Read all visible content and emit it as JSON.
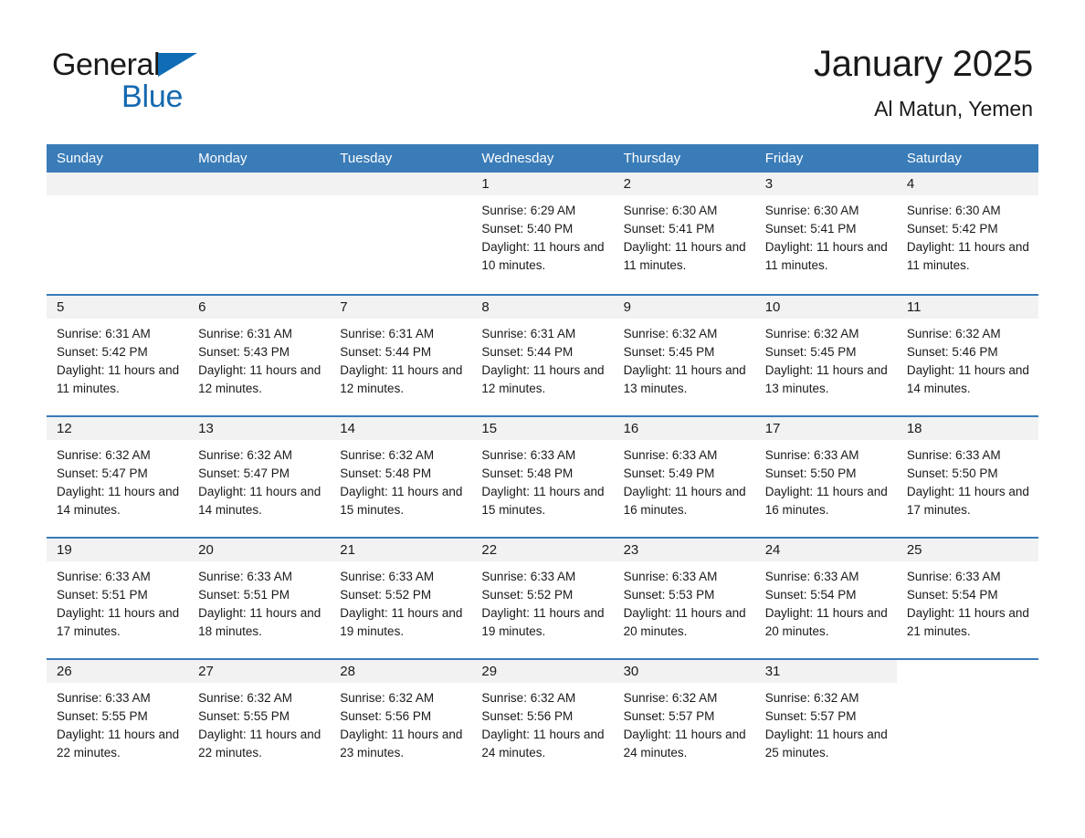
{
  "brand": {
    "name_part1": "General",
    "name_part2": "Blue",
    "triangle_icon": "triangle-icon",
    "accent_color": "#1569b0"
  },
  "header": {
    "month_title": "January 2025",
    "location": "Al Matun, Yemen"
  },
  "colors": {
    "header_blue": "#3a7cb8",
    "row_divider_blue": "#3a7cb8",
    "day_band_gray": "#f2f2f2",
    "text": "#1a1a1a"
  },
  "calendar": {
    "weekdays": [
      "Sunday",
      "Monday",
      "Tuesday",
      "Wednesday",
      "Thursday",
      "Friday",
      "Saturday"
    ],
    "weeks": [
      [
        {
          "day": "",
          "empty": true
        },
        {
          "day": "",
          "empty": true
        },
        {
          "day": "",
          "empty": true
        },
        {
          "day": "1",
          "sunrise": "Sunrise: 6:29 AM",
          "sunset": "Sunset: 5:40 PM",
          "daylight": "Daylight: 11 hours and 10 minutes."
        },
        {
          "day": "2",
          "sunrise": "Sunrise: 6:30 AM",
          "sunset": "Sunset: 5:41 PM",
          "daylight": "Daylight: 11 hours and 11 minutes."
        },
        {
          "day": "3",
          "sunrise": "Sunrise: 6:30 AM",
          "sunset": "Sunset: 5:41 PM",
          "daylight": "Daylight: 11 hours and 11 minutes."
        },
        {
          "day": "4",
          "sunrise": "Sunrise: 6:30 AM",
          "sunset": "Sunset: 5:42 PM",
          "daylight": "Daylight: 11 hours and 11 minutes."
        }
      ],
      [
        {
          "day": "5",
          "sunrise": "Sunrise: 6:31 AM",
          "sunset": "Sunset: 5:42 PM",
          "daylight": "Daylight: 11 hours and 11 minutes."
        },
        {
          "day": "6",
          "sunrise": "Sunrise: 6:31 AM",
          "sunset": "Sunset: 5:43 PM",
          "daylight": "Daylight: 11 hours and 12 minutes."
        },
        {
          "day": "7",
          "sunrise": "Sunrise: 6:31 AM",
          "sunset": "Sunset: 5:44 PM",
          "daylight": "Daylight: 11 hours and 12 minutes."
        },
        {
          "day": "8",
          "sunrise": "Sunrise: 6:31 AM",
          "sunset": "Sunset: 5:44 PM",
          "daylight": "Daylight: 11 hours and 12 minutes."
        },
        {
          "day": "9",
          "sunrise": "Sunrise: 6:32 AM",
          "sunset": "Sunset: 5:45 PM",
          "daylight": "Daylight: 11 hours and 13 minutes."
        },
        {
          "day": "10",
          "sunrise": "Sunrise: 6:32 AM",
          "sunset": "Sunset: 5:45 PM",
          "daylight": "Daylight: 11 hours and 13 minutes."
        },
        {
          "day": "11",
          "sunrise": "Sunrise: 6:32 AM",
          "sunset": "Sunset: 5:46 PM",
          "daylight": "Daylight: 11 hours and 14 minutes."
        }
      ],
      [
        {
          "day": "12",
          "sunrise": "Sunrise: 6:32 AM",
          "sunset": "Sunset: 5:47 PM",
          "daylight": "Daylight: 11 hours and 14 minutes."
        },
        {
          "day": "13",
          "sunrise": "Sunrise: 6:32 AM",
          "sunset": "Sunset: 5:47 PM",
          "daylight": "Daylight: 11 hours and 14 minutes."
        },
        {
          "day": "14",
          "sunrise": "Sunrise: 6:32 AM",
          "sunset": "Sunset: 5:48 PM",
          "daylight": "Daylight: 11 hours and 15 minutes."
        },
        {
          "day": "15",
          "sunrise": "Sunrise: 6:33 AM",
          "sunset": "Sunset: 5:48 PM",
          "daylight": "Daylight: 11 hours and 15 minutes."
        },
        {
          "day": "16",
          "sunrise": "Sunrise: 6:33 AM",
          "sunset": "Sunset: 5:49 PM",
          "daylight": "Daylight: 11 hours and 16 minutes."
        },
        {
          "day": "17",
          "sunrise": "Sunrise: 6:33 AM",
          "sunset": "Sunset: 5:50 PM",
          "daylight": "Daylight: 11 hours and 16 minutes."
        },
        {
          "day": "18",
          "sunrise": "Sunrise: 6:33 AM",
          "sunset": "Sunset: 5:50 PM",
          "daylight": "Daylight: 11 hours and 17 minutes."
        }
      ],
      [
        {
          "day": "19",
          "sunrise": "Sunrise: 6:33 AM",
          "sunset": "Sunset: 5:51 PM",
          "daylight": "Daylight: 11 hours and 17 minutes."
        },
        {
          "day": "20",
          "sunrise": "Sunrise: 6:33 AM",
          "sunset": "Sunset: 5:51 PM",
          "daylight": "Daylight: 11 hours and 18 minutes."
        },
        {
          "day": "21",
          "sunrise": "Sunrise: 6:33 AM",
          "sunset": "Sunset: 5:52 PM",
          "daylight": "Daylight: 11 hours and 19 minutes."
        },
        {
          "day": "22",
          "sunrise": "Sunrise: 6:33 AM",
          "sunset": "Sunset: 5:52 PM",
          "daylight": "Daylight: 11 hours and 19 minutes."
        },
        {
          "day": "23",
          "sunrise": "Sunrise: 6:33 AM",
          "sunset": "Sunset: 5:53 PM",
          "daylight": "Daylight: 11 hours and 20 minutes."
        },
        {
          "day": "24",
          "sunrise": "Sunrise: 6:33 AM",
          "sunset": "Sunset: 5:54 PM",
          "daylight": "Daylight: 11 hours and 20 minutes."
        },
        {
          "day": "25",
          "sunrise": "Sunrise: 6:33 AM",
          "sunset": "Sunset: 5:54 PM",
          "daylight": "Daylight: 11 hours and 21 minutes."
        }
      ],
      [
        {
          "day": "26",
          "sunrise": "Sunrise: 6:33 AM",
          "sunset": "Sunset: 5:55 PM",
          "daylight": "Daylight: 11 hours and 22 minutes."
        },
        {
          "day": "27",
          "sunrise": "Sunrise: 6:32 AM",
          "sunset": "Sunset: 5:55 PM",
          "daylight": "Daylight: 11 hours and 22 minutes."
        },
        {
          "day": "28",
          "sunrise": "Sunrise: 6:32 AM",
          "sunset": "Sunset: 5:56 PM",
          "daylight": "Daylight: 11 hours and 23 minutes."
        },
        {
          "day": "29",
          "sunrise": "Sunrise: 6:32 AM",
          "sunset": "Sunset: 5:56 PM",
          "daylight": "Daylight: 11 hours and 24 minutes."
        },
        {
          "day": "30",
          "sunrise": "Sunrise: 6:32 AM",
          "sunset": "Sunset: 5:57 PM",
          "daylight": "Daylight: 11 hours and 24 minutes."
        },
        {
          "day": "31",
          "sunrise": "Sunrise: 6:32 AM",
          "sunset": "Sunset: 5:57 PM",
          "daylight": "Daylight: 11 hours and 25 minutes."
        },
        {
          "day": "",
          "empty": true,
          "blank": true
        }
      ]
    ]
  }
}
